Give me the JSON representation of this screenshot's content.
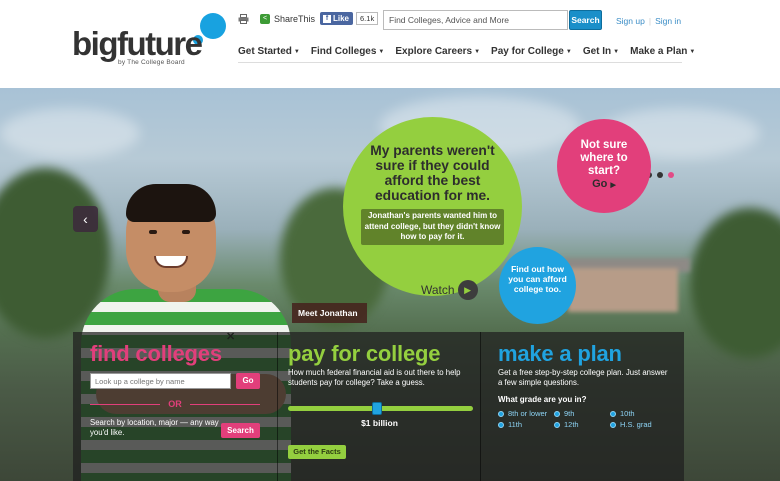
{
  "header": {
    "logo": {
      "wordmark": "bigfuture",
      "tagline": "by The College Board"
    },
    "share_label": "ShareThis",
    "facebook": {
      "like_label": "Like",
      "count": "6.1k"
    },
    "search": {
      "placeholder": "Find Colleges, Advice and More",
      "button_label": "Search"
    },
    "auth": {
      "signup": "Sign up",
      "signin": "Sign in"
    },
    "nav": [
      {
        "label": "Get Started"
      },
      {
        "label": "Find Colleges"
      },
      {
        "label": "Explore Careers"
      },
      {
        "label": "Pay for College"
      },
      {
        "label": "Get In"
      },
      {
        "label": "Make a Plan"
      }
    ]
  },
  "hero": {
    "slide_count": 3,
    "active_slide": 3,
    "person_caption": "Meet Jonathan",
    "quote": "My parents weren't sure if they could afford the best education for me.",
    "quote_sub": "Jonathan's parents wanted him to attend college, but they didn't know how to pay for it.",
    "watch_label": "Watch",
    "cta_pink": {
      "text": "Not sure where to start?",
      "link": "Go"
    },
    "cta_blue": {
      "text": "Find out how you can afford college too."
    },
    "colors": {
      "green": "#94cf3f",
      "pink": "#e23f7b",
      "blue": "#20a3e0"
    }
  },
  "panels": {
    "find": {
      "title": "find colleges",
      "input_placeholder": "Look up a college by name",
      "go_label": "Go",
      "or_label": "OR",
      "description": "Search by location, major — any way you'd like.",
      "search_label": "Search"
    },
    "pay": {
      "title": "pay for college",
      "description": "How much federal financial aid is out there to help students pay for college? Take a guess.",
      "slider_value": "$1 billion",
      "slider_position": 0.48,
      "button_label": "Get the Facts"
    },
    "plan": {
      "title": "make a plan",
      "description": "Get a free step-by-step college plan. Just answer a few simple questions.",
      "question": "What grade are you in?",
      "grades": [
        "8th or lower",
        "9th",
        "10th",
        "11th",
        "12th",
        "H.S. grad"
      ]
    }
  }
}
